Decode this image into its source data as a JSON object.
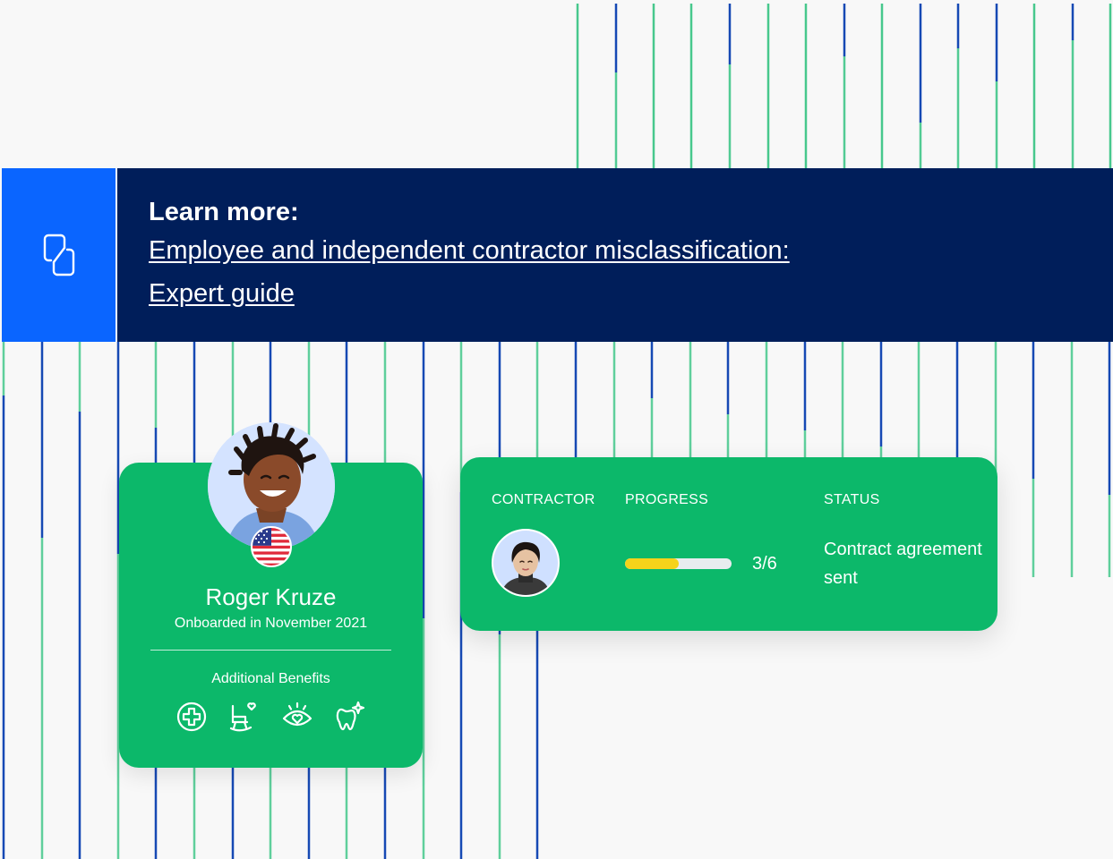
{
  "banner": {
    "heading": "Learn more:",
    "link_line1": "Employee and independent contractor misclassification:",
    "link_line2": "Expert guide",
    "icon": "document-link-icon",
    "colors": {
      "background": "#001e5a",
      "icon_box": "#0a65ff"
    }
  },
  "profile_card": {
    "name": "Roger Kruze",
    "subtitle": "Onboarded in November 2021",
    "benefits_label": "Additional Benefits",
    "flag_icon": "us-flag-icon",
    "benefit_icons": [
      "medical-cross-icon",
      "rocking-chair-heart-icon",
      "eye-heart-icon",
      "tooth-sparkle-icon"
    ],
    "color": "#0cb86a"
  },
  "contractor_card": {
    "headers": {
      "contractor": "CONTRACTOR",
      "progress": "PROGRESS",
      "status": "STATUS"
    },
    "progress": {
      "completed": 3,
      "total": 6,
      "label": "3/6"
    },
    "status": "Contract agreement sent",
    "colors": {
      "progress_fill": "#f5d31a",
      "progress_track": "#e8ecef"
    }
  },
  "decor": {
    "stripe_colors": [
      "#0cb86a",
      "#0a3fb0"
    ]
  }
}
